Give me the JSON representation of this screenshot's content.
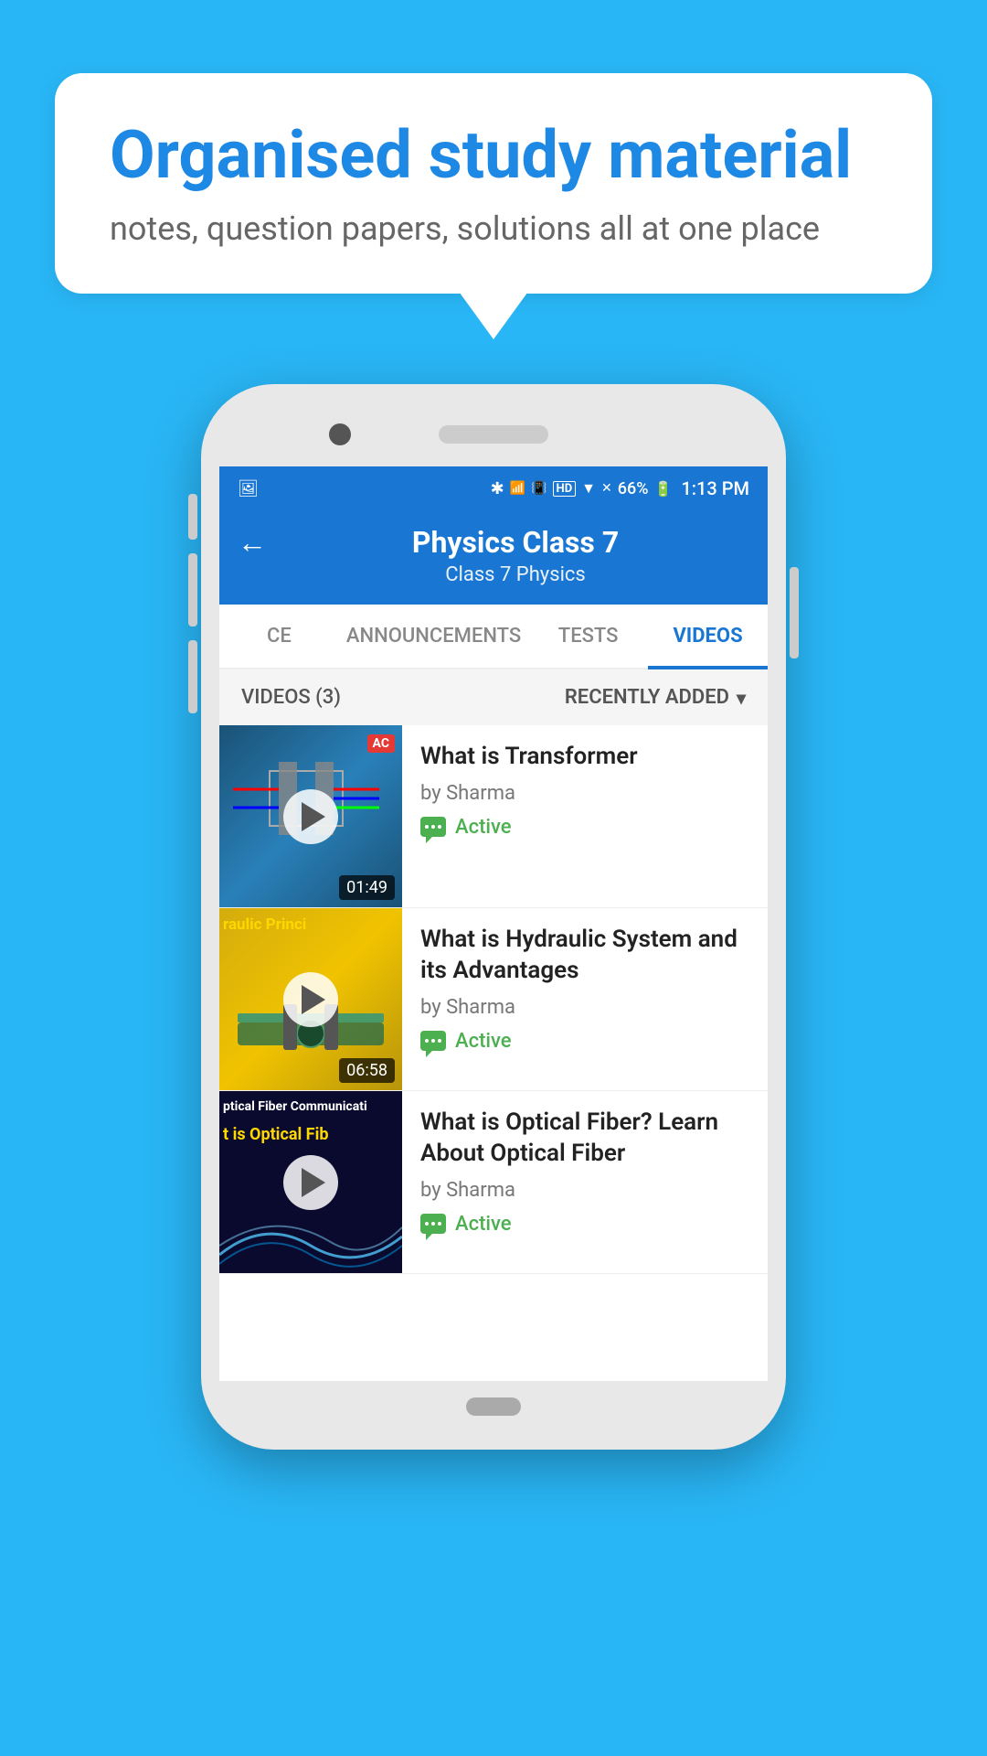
{
  "page": {
    "background_color": "#29b6f6"
  },
  "speech_bubble": {
    "title": "Organised study material",
    "subtitle": "notes, question papers, solutions all at one place"
  },
  "status_bar": {
    "battery": "66%",
    "time": "1:13 PM",
    "icons": [
      "bluetooth",
      "vibrate",
      "hd",
      "wifi",
      "signal",
      "signal-x"
    ]
  },
  "app_bar": {
    "back_label": "←",
    "title": "Physics Class 7",
    "breadcrumb": "Class 7   Physics"
  },
  "tabs": [
    {
      "id": "ce",
      "label": "CE",
      "active": false
    },
    {
      "id": "announcements",
      "label": "ANNOUNCEMENTS",
      "active": false
    },
    {
      "id": "tests",
      "label": "TESTS",
      "active": false
    },
    {
      "id": "videos",
      "label": "VIDEOS",
      "active": true
    }
  ],
  "filter_bar": {
    "count_label": "VIDEOS (3)",
    "sort_label": "RECENTLY ADDED",
    "sort_icon": "chevron-down"
  },
  "videos": [
    {
      "id": 1,
      "title": "What is  Transformer",
      "author": "by Sharma",
      "status": "Active",
      "duration": "01:49",
      "thumbnail_type": "transformer"
    },
    {
      "id": 2,
      "title": "What is Hydraulic System and its Advantages",
      "author": "by Sharma",
      "status": "Active",
      "duration": "06:58",
      "thumbnail_type": "hydraulic"
    },
    {
      "id": 3,
      "title": "What is Optical Fiber? Learn About Optical Fiber",
      "author": "by Sharma",
      "status": "Active",
      "duration": "",
      "thumbnail_type": "optical"
    }
  ],
  "thumbnail_labels": {
    "hydraulic": "raulic Princi",
    "optical_line1": "ptical Fiber Communicati",
    "optical_line2": "t is Optical Fib"
  }
}
